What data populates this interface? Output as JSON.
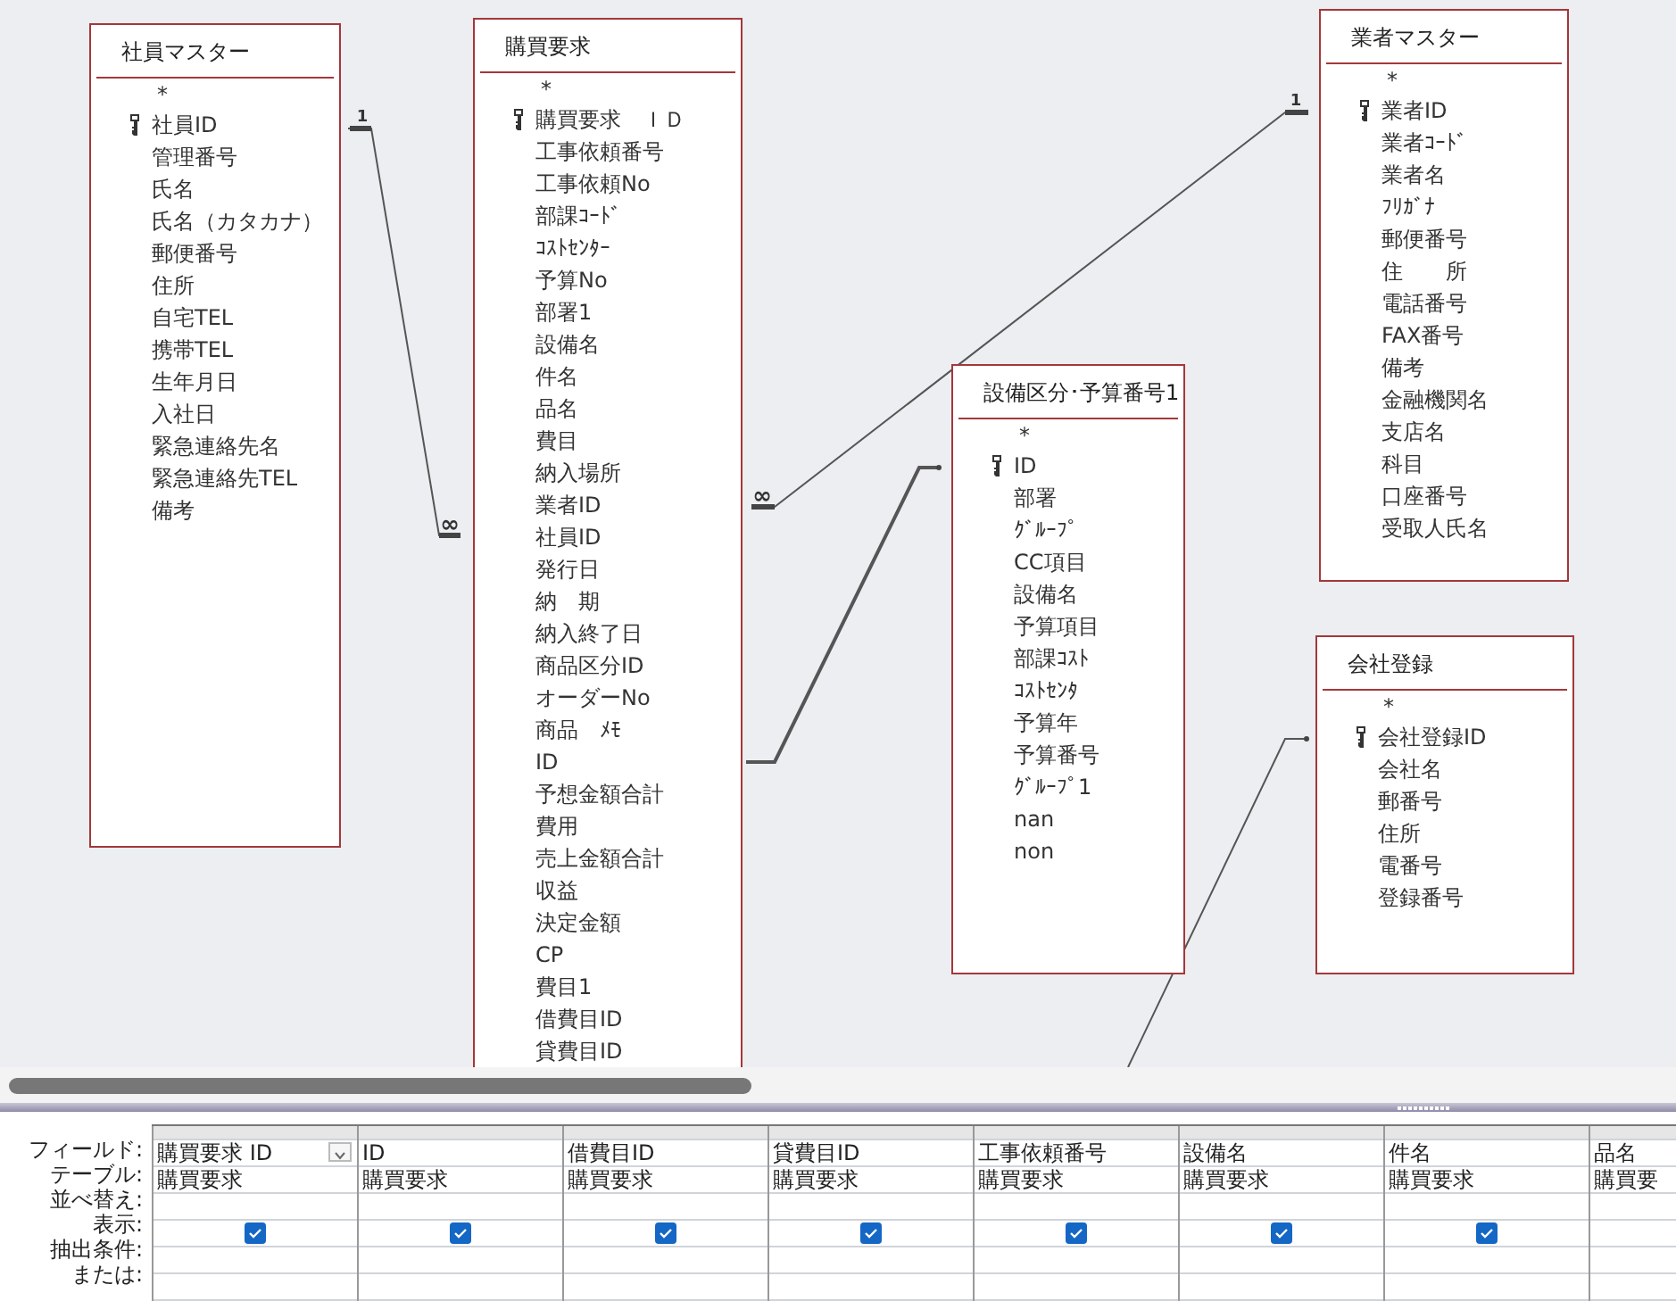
{
  "tables": [
    {
      "title": "社員マスター",
      "fields": [
        {
          "name": "*",
          "primary_key": false
        },
        {
          "name": "社員ID",
          "primary_key": true
        },
        {
          "name": "管理番号",
          "primary_key": false
        },
        {
          "name": "氏名",
          "primary_key": false
        },
        {
          "name": "氏名（カタカナ）",
          "primary_key": false
        },
        {
          "name": "郵便番号",
          "primary_key": false
        },
        {
          "name": "住所",
          "primary_key": false
        },
        {
          "name": "自宅TEL",
          "primary_key": false
        },
        {
          "name": "携帯TEL",
          "primary_key": false
        },
        {
          "name": "生年月日",
          "primary_key": false
        },
        {
          "name": "入社日",
          "primary_key": false
        },
        {
          "name": "緊急連絡先名",
          "primary_key": false
        },
        {
          "name": "緊急連絡先TEL",
          "primary_key": false
        },
        {
          "name": "備考",
          "primary_key": false
        }
      ]
    },
    {
      "title": "購買要求",
      "fields": [
        {
          "name": "*",
          "primary_key": false
        },
        {
          "name": "購買要求　ＩＤ",
          "primary_key": true
        },
        {
          "name": "工事依頼番号",
          "primary_key": false
        },
        {
          "name": "工事依頼No",
          "primary_key": false
        },
        {
          "name": "部課ｺｰﾄﾞ",
          "primary_key": false
        },
        {
          "name": "ｺｽﾄｾﾝﾀｰ",
          "primary_key": false
        },
        {
          "name": "予算No",
          "primary_key": false
        },
        {
          "name": "部署1",
          "primary_key": false
        },
        {
          "name": "設備名",
          "primary_key": false
        },
        {
          "name": "件名",
          "primary_key": false
        },
        {
          "name": "品名",
          "primary_key": false
        },
        {
          "name": "費目",
          "primary_key": false
        },
        {
          "name": "納入場所",
          "primary_key": false
        },
        {
          "name": "業者ID",
          "primary_key": false
        },
        {
          "name": "社員ID",
          "primary_key": false
        },
        {
          "name": "発行日",
          "primary_key": false
        },
        {
          "name": "納　期",
          "primary_key": false
        },
        {
          "name": "納入終了日",
          "primary_key": false
        },
        {
          "name": "商品区分ID",
          "primary_key": false
        },
        {
          "name": "オーダーNo",
          "primary_key": false
        },
        {
          "name": "商品　ﾒﾓ",
          "primary_key": false
        },
        {
          "name": "ID",
          "primary_key": false
        },
        {
          "name": "予想金額合計",
          "primary_key": false
        },
        {
          "name": "費用",
          "primary_key": false
        },
        {
          "name": "売上金額合計",
          "primary_key": false
        },
        {
          "name": "収益",
          "primary_key": false
        },
        {
          "name": "決定金額",
          "primary_key": false
        },
        {
          "name": "CP",
          "primary_key": false
        },
        {
          "name": "費目1",
          "primary_key": false
        },
        {
          "name": "借費目ID",
          "primary_key": false
        },
        {
          "name": "貸費目ID",
          "primary_key": false
        }
      ]
    },
    {
      "title": "業者マスター",
      "fields": [
        {
          "name": "*",
          "primary_key": false
        },
        {
          "name": "業者ID",
          "primary_key": true
        },
        {
          "name": "業者ｺｰﾄﾞ",
          "primary_key": false
        },
        {
          "name": "業者名",
          "primary_key": false
        },
        {
          "name": "ﾌﾘｶﾞﾅ",
          "primary_key": false
        },
        {
          "name": "郵便番号",
          "primary_key": false
        },
        {
          "name": "住　　所",
          "primary_key": false
        },
        {
          "name": "電話番号",
          "primary_key": false
        },
        {
          "name": "FAX番号",
          "primary_key": false
        },
        {
          "name": "備考",
          "primary_key": false
        },
        {
          "name": "金融機関名",
          "primary_key": false
        },
        {
          "name": "支店名",
          "primary_key": false
        },
        {
          "name": "科目",
          "primary_key": false
        },
        {
          "name": "口座番号",
          "primary_key": false
        },
        {
          "name": "受取人氏名",
          "primary_key": false
        }
      ]
    },
    {
      "title": "設備区分･予算番号1",
      "fields": [
        {
          "name": "*",
          "primary_key": false
        },
        {
          "name": "ID",
          "primary_key": true
        },
        {
          "name": "部署",
          "primary_key": false
        },
        {
          "name": "ｸﾞﾙｰﾌﾟ",
          "primary_key": false
        },
        {
          "name": "CC項目",
          "primary_key": false
        },
        {
          "name": "設備名",
          "primary_key": false
        },
        {
          "name": "予算項目",
          "primary_key": false
        },
        {
          "name": "部課ｺｽﾄ",
          "primary_key": false
        },
        {
          "name": "ｺｽﾄｾﾝﾀ",
          "primary_key": false
        },
        {
          "name": "予算年",
          "primary_key": false
        },
        {
          "name": "予算番号",
          "primary_key": false
        },
        {
          "name": "ｸﾞﾙｰﾌﾟ1",
          "primary_key": false
        },
        {
          "name": "nan",
          "primary_key": false
        },
        {
          "name": "non",
          "primary_key": false
        }
      ]
    },
    {
      "title": "会社登録",
      "fields": [
        {
          "name": "*",
          "primary_key": false
        },
        {
          "name": "会社登録ID",
          "primary_key": true
        },
        {
          "name": "会社名",
          "primary_key": false
        },
        {
          "name": "郵番号",
          "primary_key": false
        },
        {
          "name": "住所",
          "primary_key": false
        },
        {
          "name": "電番号",
          "primary_key": false
        },
        {
          "name": "登録番号",
          "primary_key": false
        }
      ]
    }
  ],
  "relationships": [
    {
      "kind": "one-to-many",
      "one_label": "1",
      "many_label": "∞"
    },
    {
      "kind": "one-to-many",
      "one_label": "1",
      "many_label": "∞"
    },
    {
      "kind": "join"
    },
    {
      "kind": "join"
    }
  ],
  "grid": {
    "row_labels": [
      "フィールド:",
      "テーブル:",
      "並べ替え:",
      "表示:",
      "抽出条件:",
      "または:"
    ],
    "columns": [
      {
        "field": "購買要求 ID",
        "table": "購買要求",
        "show": true,
        "selected": true
      },
      {
        "field": "ID",
        "table": "購買要求",
        "show": true,
        "selected": false
      },
      {
        "field": "借費目ID",
        "table": "購買要求",
        "show": true,
        "selected": false
      },
      {
        "field": "貸費目ID",
        "table": "購買要求",
        "show": true,
        "selected": false
      },
      {
        "field": "工事依頼番号",
        "table": "購買要求",
        "show": true,
        "selected": false
      },
      {
        "field": "設備名",
        "table": "購買要求",
        "show": true,
        "selected": false
      },
      {
        "field": "件名",
        "table": "購買要求",
        "show": true,
        "selected": false
      },
      {
        "field": "品名",
        "table": "購買要",
        "selected": false
      }
    ]
  }
}
